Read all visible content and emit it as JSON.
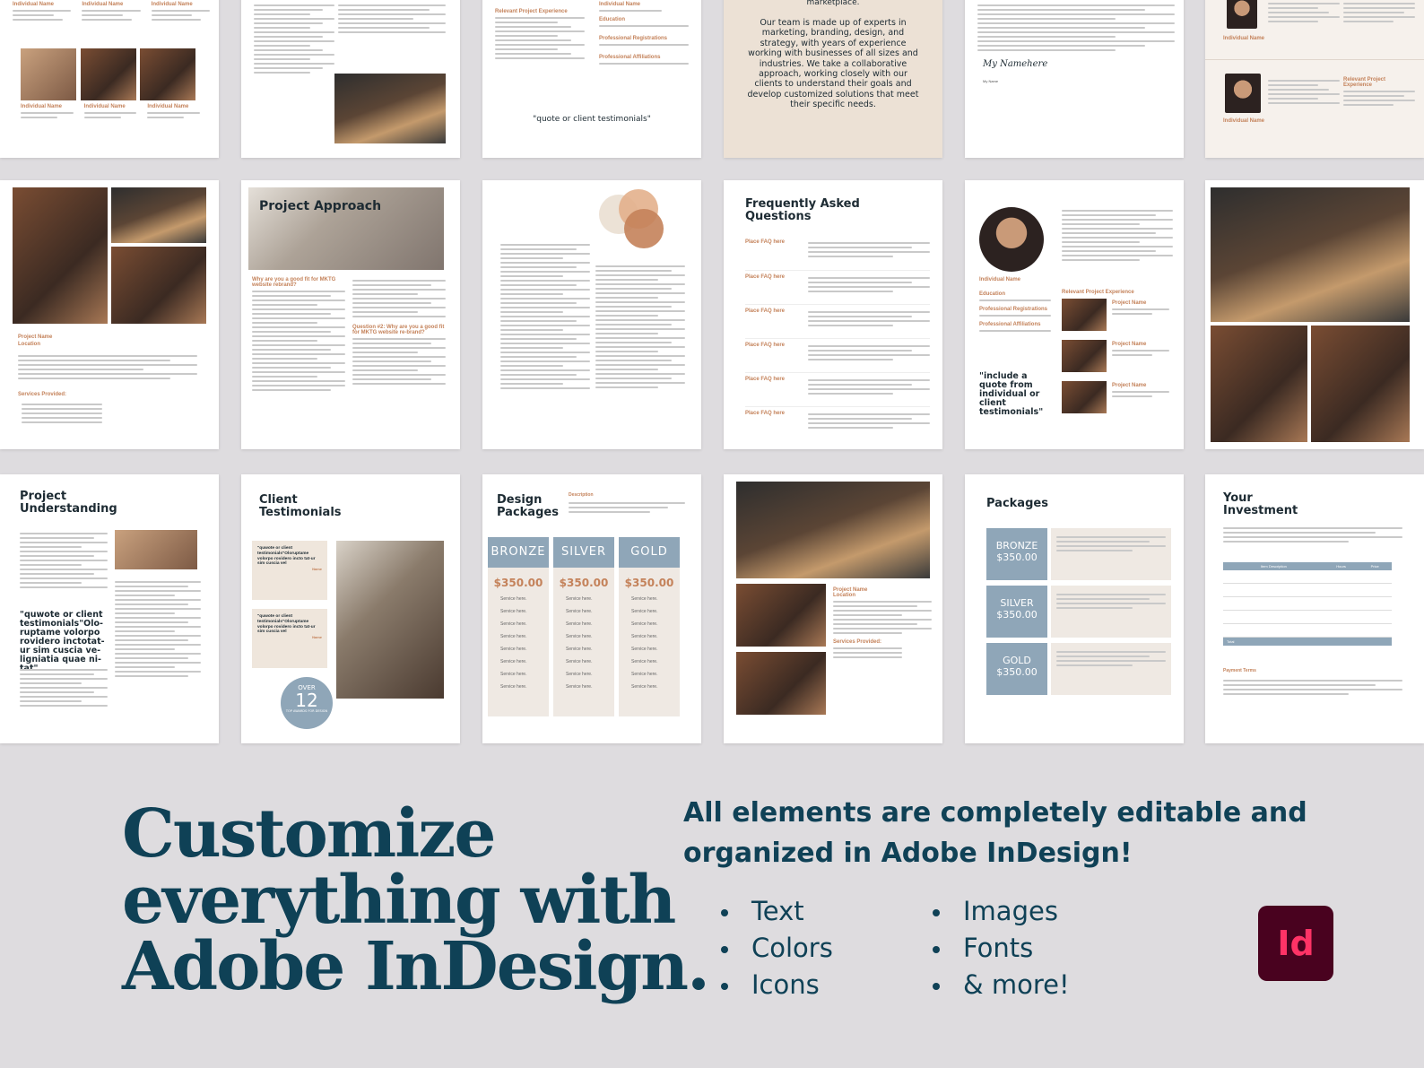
{
  "hero": {
    "headline_lines": [
      "Customize",
      "everything with",
      "Adobe InDesign."
    ],
    "subtitle": "All elements are completely editable and organized in Adobe InDesign!",
    "features_left": [
      "Text",
      "Colors",
      "Icons"
    ],
    "features_right": [
      "Images",
      "Fonts",
      "& more!"
    ],
    "logo_text": "Id",
    "colors": {
      "background": "#dedcdf",
      "headline": "#0f4156",
      "logo_bg": "#49021f",
      "logo_fg": "#ff3366",
      "accent": "#c4825a",
      "package_blue": "#8fa6b8"
    }
  },
  "pages": {
    "team": {
      "name_label": "Individual Name",
      "role_label": "Project Role"
    },
    "experience": {
      "relevant": "Relevant Project Experience",
      "education": "Education",
      "registrations": "Professional Registrations",
      "affiliations": "Professional Affiliations",
      "quote": "\"quote or client testimonials\""
    },
    "about": {
      "marketplace": "marketplace.",
      "text": "Our team is made up of experts in marketing, branding, design, and strategy, with years of experience working with businesses of all sizes and industries. We take a collaborative approach, working closely with our clients to understand their goals and develop customized solutions that meet their specific needs."
    },
    "letter": {
      "signature": "My Namehere",
      "name": "My Name"
    },
    "project": {
      "name": "Project Name",
      "location": "Location",
      "services": "Services Provided:"
    },
    "approach": {
      "title": "Project Approach",
      "q1": "Why are you a good fit for MKTG website rebrand?",
      "q2": "Question #2: Why are you a good fit for MKTG website re-brand?"
    },
    "faq": {
      "title": "Frequently Asked Questions",
      "item_label": "Place FAQ here"
    },
    "bio": {
      "quote": "\"include a quote from individual or client testimonials\""
    },
    "understanding": {
      "title": "Project Understanding",
      "quote": "\"quwote or client testimonials\"Olo-ruptame volorpo rovidero inctotat-ur sim cuscia ve-ligniatia quae ni-tat\""
    },
    "testimonials": {
      "title": "Client Testimonials",
      "quote": "\"quwote or client testimonials\"Oloruptame volorpo rovidero incto tat-ur sim cuscia vel",
      "name": "Name",
      "badge_over": "OVER",
      "badge_num": "12",
      "badge_sub": "TOP AWARDS FOR DESIGN"
    },
    "design_packages": {
      "title": "Design Packages",
      "desc": "Description",
      "tiers": [
        "BRONZE",
        "SILVER",
        "GOLD"
      ],
      "price": "$350.00",
      "service": "Service here."
    },
    "packages": {
      "title": "Packages",
      "tiers": [
        "BRONZE",
        "SILVER",
        "GOLD"
      ],
      "price": "$350.00"
    },
    "investment": {
      "title": "Your Investment",
      "cols": [
        "Item Description",
        "Hours",
        "Price"
      ],
      "total": "Total",
      "terms": "Payment Terms"
    }
  }
}
